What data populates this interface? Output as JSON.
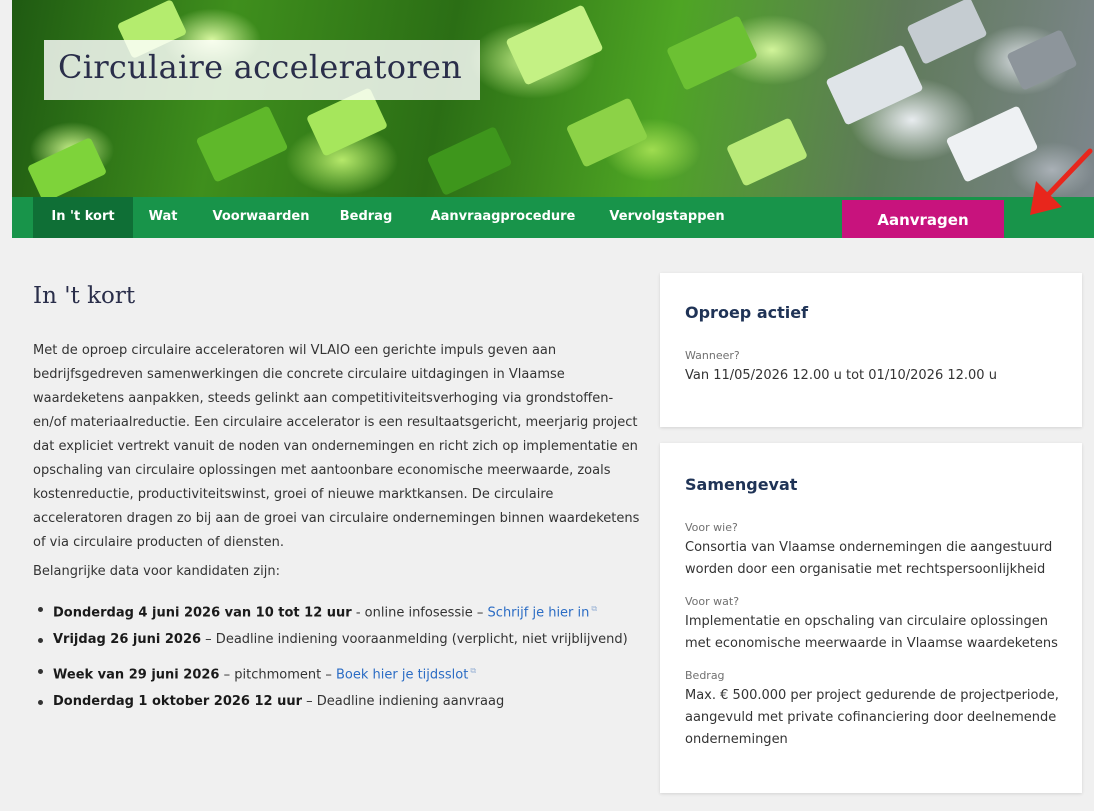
{
  "hero": {
    "title": "Circulaire acceleratoren"
  },
  "nav": {
    "items": [
      {
        "label": "In 't kort",
        "active": true
      },
      {
        "label": "Wat",
        "active": false
      },
      {
        "label": "Voorwaarden",
        "active": false
      },
      {
        "label": "Bedrag",
        "active": false
      },
      {
        "label": "Aanvraagprocedure",
        "active": false
      },
      {
        "label": "Vervolgstappen",
        "active": false
      }
    ],
    "apply_button": "Aanvragen"
  },
  "main": {
    "heading": "In 't kort",
    "intro": "Met de oproep circulaire acceleratoren wil VLAIO een gerichte impuls geven aan bedrijfsgedreven samenwerkingen die concrete circulaire uitdagingen in Vlaamse waardeketens aanpakken, steeds gelinkt aan competitiviteitsverhoging via grondstoffen- en/of materiaalreductie. Een circulaire accelerator is een resultaatsgericht, meerjarig project dat expliciet vertrekt vanuit de noden van ondernemingen en richt zich op implementatie en opschaling van circulaire oplossingen met aantoonbare economische meerwaarde, zoals kostenreductie, productiviteitswinst, groei of nieuwe marktkansen. De circulaire acceleratoren dragen zo bij aan de groei van circulaire ondernemingen binnen waardeketens of via circulaire producten of diensten.",
    "data_intro": "Belangrijke data voor kandidaten zijn:",
    "dates": [
      {
        "bold": "Donderdag 4  juni 2026 van 10 tot 12 uur",
        "text": " - online infosessie – ",
        "link": "Schrijf je hier in"
      },
      {
        "bold": "Vrijdag 26 juni 2026",
        "text": " – Deadline indiening vooraanmelding (verplicht, niet vrijblijvend)",
        "link": ""
      },
      {
        "bold": "Week van 29 juni 2026",
        "text": " – pitchmoment – ",
        "link": "Boek hier je tijdsslot"
      },
      {
        "bold": "Donderdag 1 oktober 2026 12 uur",
        "text": " – Deadline indiening aanvraag",
        "link": ""
      }
    ]
  },
  "call_card": {
    "title": "Oproep actief",
    "when_label": "Wanneer?",
    "when_value": "Van 11/05/2026 12.00 u tot 01/10/2026 12.00 u"
  },
  "summary_card": {
    "title": "Samengevat",
    "for_who_label": "Voor wie?",
    "for_who_value": "Consortia van Vlaamse ondernemingen die aangestuurd worden door een organisatie met rechtspersoonlijkheid",
    "for_what_label": "Voor wat?",
    "for_what_value": "Implementatie en opschaling van circulaire oplossingen met economische meerwaarde in Vlaamse waardeketens",
    "amount_label": "Bedrag",
    "amount_value": "Max. € 500.000 per project gedurende de projectperiode, aangevuld met private cofinanciering door deelnemende ondernemingen"
  },
  "colors": {
    "nav_green": "#18944a",
    "nav_active": "#0f6f36",
    "apply_magenta": "#c8137d",
    "link_blue": "#2b6cc4",
    "card_title": "#1f3356",
    "arrow_red": "#e8261c"
  },
  "icons": {
    "external_link": "external-link-icon",
    "annotation_arrow": "red-arrow-icon"
  }
}
